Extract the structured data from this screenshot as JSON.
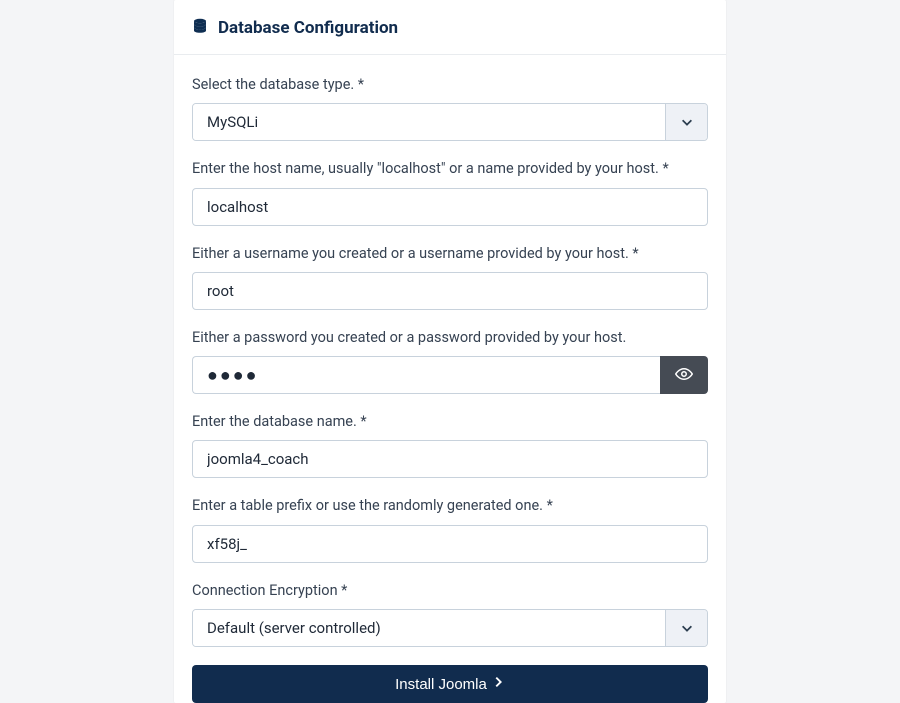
{
  "header": {
    "title": "Database Configuration"
  },
  "fields": {
    "db_type": {
      "label": "Select the database type. *",
      "value": "MySQLi"
    },
    "host": {
      "label": "Enter the host name, usually \"localhost\" or a name provided by your host. *",
      "value": "localhost"
    },
    "username": {
      "label": "Either a username you created or a username provided by your host. *",
      "value": "root"
    },
    "password": {
      "label": "Either a password you created or a password provided by your host.",
      "value_masked": "●●●●"
    },
    "dbname": {
      "label": "Enter the database name. *",
      "value": "joomla4_coach"
    },
    "prefix": {
      "label": "Enter a table prefix or use the randomly generated one. *",
      "value": "xf58j_"
    },
    "encryption": {
      "label": "Connection Encryption *",
      "value": "Default (server controlled)"
    }
  },
  "buttons": {
    "install": "Install Joomla"
  }
}
